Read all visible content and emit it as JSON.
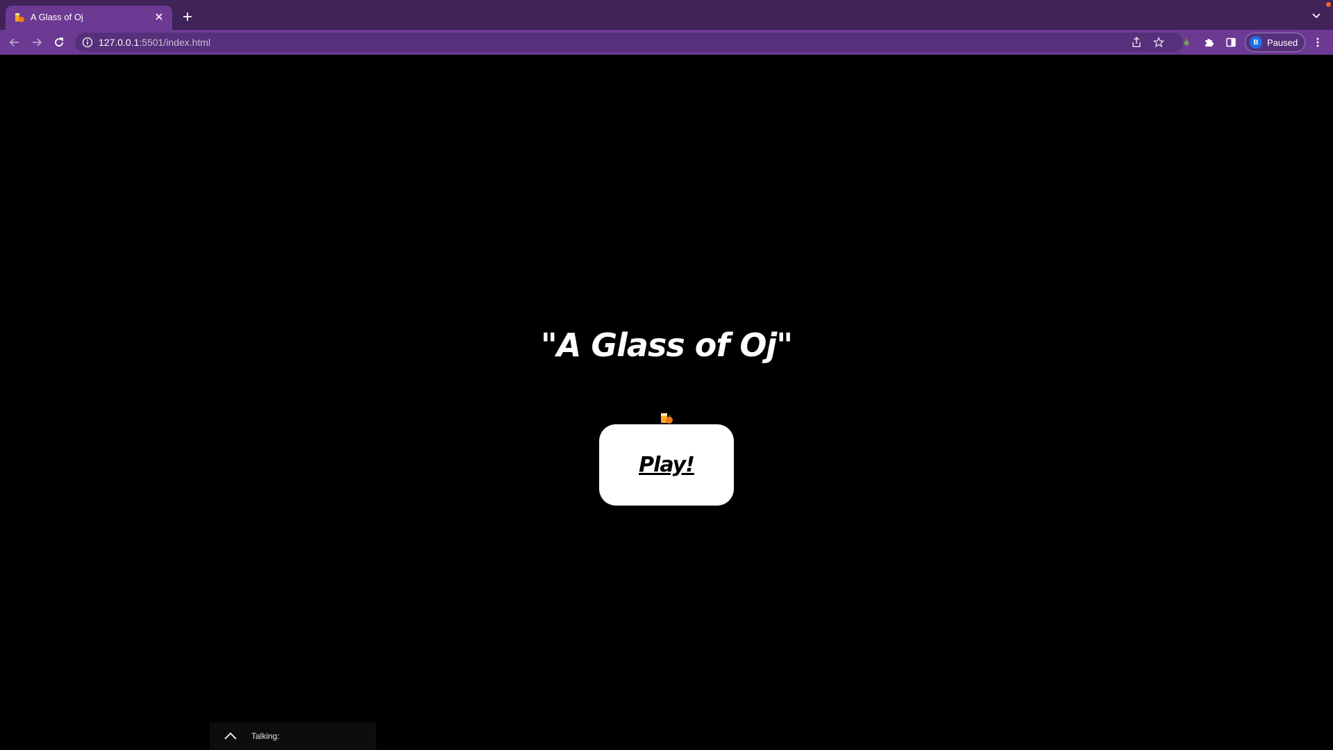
{
  "browser": {
    "tab": {
      "title": "A Glass of Oj"
    },
    "address": {
      "host": "127.0.0.1",
      "port_path": ":5501/index.html"
    },
    "profile": {
      "initial": "B",
      "status": "Paused"
    }
  },
  "page": {
    "title": "\"A Glass of Oj\"",
    "play_button": "Play!",
    "talk_panel": {
      "label": "Talking:"
    }
  },
  "colors": {
    "tabstrip": "#3f2359",
    "toolbar": "#6d3a93",
    "page_background": "#000000",
    "button": "#ffffff"
  },
  "icons": [
    "orange-juice-favicon",
    "close-icon",
    "plus-icon",
    "chevron-down-icon",
    "back-arrow-icon",
    "forward-arrow-icon",
    "reload-icon",
    "info-icon",
    "share-icon",
    "star-icon",
    "extension-dot-icon",
    "puzzle-icon",
    "sidepanel-icon",
    "more-vert-icon",
    "orange-juice-glass-icon",
    "chevron-up-icon"
  ]
}
